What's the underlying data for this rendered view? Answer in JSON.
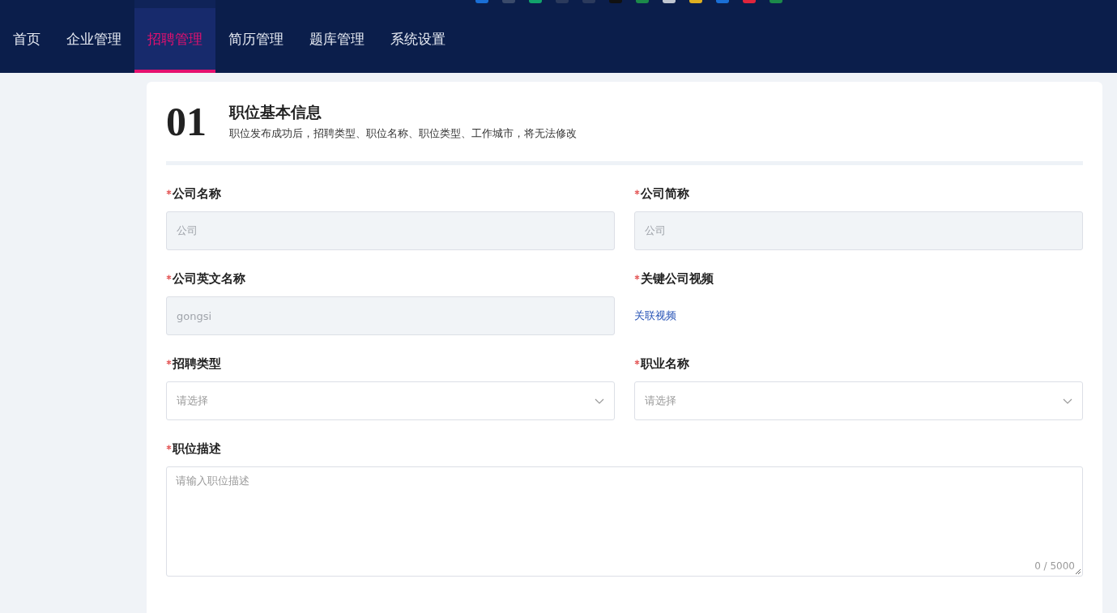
{
  "nav": {
    "tabs": [
      {
        "label": "首页",
        "selected": false
      },
      {
        "label": "企业管理",
        "selected": false
      },
      {
        "label": "招聘管理",
        "selected": true
      },
      {
        "label": "简历管理",
        "selected": false
      },
      {
        "label": "题库管理",
        "selected": false
      },
      {
        "label": "系统设置",
        "selected": false
      }
    ]
  },
  "section": {
    "number": "01",
    "title": "职位基本信息",
    "subtitle": "职位发布成功后，招聘类型、职位名称、职位类型、工作城市，将无法修改"
  },
  "fields": [
    {
      "kind": "input",
      "label": "公司名称",
      "required": true,
      "value": "公司",
      "disabled": true
    },
    {
      "kind": "input",
      "label": "公司简称",
      "required": true,
      "value": "公司",
      "disabled": true
    },
    {
      "kind": "input",
      "label": "公司英文名称",
      "required": true,
      "value": "gongsi",
      "disabled": true
    },
    {
      "kind": "link",
      "label": "关键公司视频",
      "required": true,
      "link": "关联视频"
    },
    {
      "kind": "select",
      "label": "招聘类型",
      "required": true,
      "placeholder": "请选择"
    },
    {
      "kind": "select",
      "label": "职业名称",
      "required": true,
      "placeholder": "请选择"
    },
    {
      "kind": "textarea",
      "label": "职位描述",
      "required": true,
      "placeholder": "请输入职位描述",
      "counter": "0 / 5000"
    }
  ]
}
